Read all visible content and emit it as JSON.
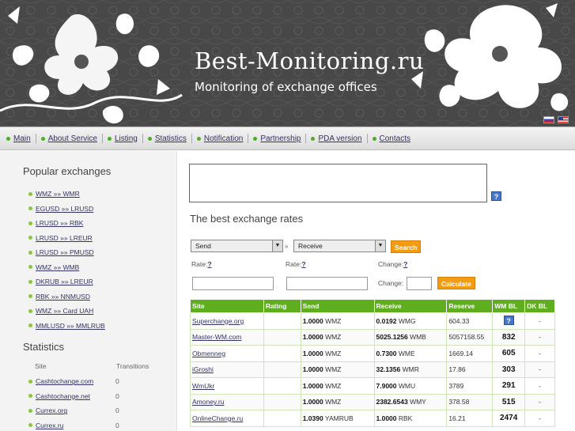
{
  "header": {
    "site_title": "Best-Monitoring.ru",
    "tagline": "Monitoring of exchange offices"
  },
  "nav": [
    "Main",
    "About Service",
    "Listing",
    "Statistics",
    "Notification",
    "Partnership",
    "PDA version",
    "Contacts"
  ],
  "sidebar": {
    "popular_title": "Popular exchanges",
    "popular": [
      "WMZ »» WMR",
      "EGUSD »» LRUSD",
      "LRUSD »» RBK",
      "LRUSD »» LREUR",
      "LRUSD »» PMUSD",
      "WMZ »» WMB",
      "DKRUB »» LREUR",
      "RBK »» NNMUSD",
      "WMZ »» Card UAH",
      "MMLUSD »» MMLRUB"
    ],
    "stats_title": "Statistics",
    "stats_head": {
      "site": "Site",
      "transitions": "Transitions"
    },
    "stats": [
      {
        "site": "Cashtochange.com",
        "count": "0"
      },
      {
        "site": "Cashtochange.net",
        "count": "0"
      },
      {
        "site": "Currex.org",
        "count": "0"
      },
      {
        "site": "Currex.ru",
        "count": "0"
      }
    ]
  },
  "main": {
    "help_glyph": "?",
    "best_title": "The best exchange rates",
    "send_select": "Send",
    "receive_select": "Receive",
    "arrows": "»",
    "search_btn": "Search",
    "rate_label": "Rate:",
    "rate_q": "?",
    "change_label": "Change:",
    "change_q": "?",
    "calc_btn": "Calculate"
  },
  "table": {
    "headers": [
      "Site",
      "Rating",
      "Send",
      "Receive",
      "Reserve",
      "WM BL",
      "DK BL"
    ],
    "rows": [
      {
        "site": "Superchange.org",
        "rating": "",
        "send_amt": "1.0000",
        "send_cur": "WMZ",
        "recv_amt": "0.0192",
        "recv_cur": "WMG",
        "reserve": "604.33",
        "wmbl": "?",
        "dkbl": "-"
      },
      {
        "site": "Master-WM.com",
        "rating": "",
        "send_amt": "1.0000",
        "send_cur": "WMZ",
        "recv_amt": "5025.1256",
        "recv_cur": "WMB",
        "reserve": "5057158.55",
        "wmbl": "832",
        "dkbl": "-"
      },
      {
        "site": "Obmenneg",
        "rating": "",
        "send_amt": "1.0000",
        "send_cur": "WMZ",
        "recv_amt": "0.7300",
        "recv_cur": "WME",
        "reserve": "1669.14",
        "wmbl": "605",
        "dkbl": "-"
      },
      {
        "site": "iGroshi",
        "rating": "",
        "send_amt": "1.0000",
        "send_cur": "WMZ",
        "recv_amt": "32.1356",
        "recv_cur": "WMR",
        "reserve": "17.86",
        "wmbl": "303",
        "dkbl": "-"
      },
      {
        "site": "WmUkr",
        "rating": "",
        "send_amt": "1.0000",
        "send_cur": "WMZ",
        "recv_amt": "7.9000",
        "recv_cur": "WMU",
        "reserve": "3789",
        "wmbl": "291",
        "dkbl": "-"
      },
      {
        "site": "Amoney.ru",
        "rating": "",
        "send_amt": "1.0000",
        "send_cur": "WMZ",
        "recv_amt": "2382.6543",
        "recv_cur": "WMY",
        "reserve": "378.58",
        "wmbl": "515",
        "dkbl": "-"
      },
      {
        "site": "OnlineChange.ru",
        "rating": "",
        "send_amt": "1.0390",
        "send_cur": "YAMRUB",
        "recv_amt": "1.0000",
        "recv_cur": "RBK",
        "reserve": "16.21",
        "wmbl": "2474",
        "dkbl": "-"
      }
    ]
  }
}
